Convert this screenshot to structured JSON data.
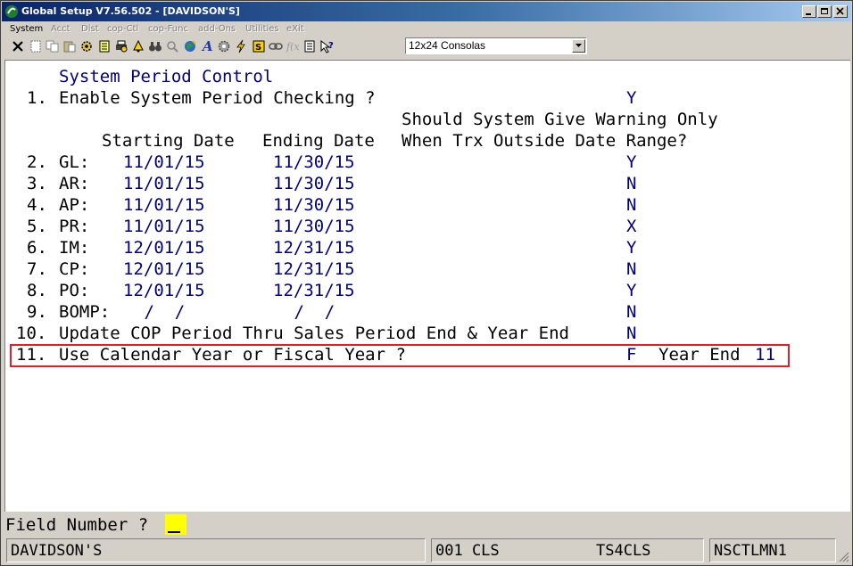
{
  "window": {
    "title": "Global Setup V7.56.502 - [DAVIDSON'S]"
  },
  "menu": {
    "items": [
      {
        "label": "System",
        "enabled": true
      },
      {
        "label": "Acct",
        "enabled": false
      },
      {
        "label": "Dist",
        "enabled": false
      },
      {
        "label": "cop-Ctl",
        "enabled": false
      },
      {
        "label": "cop-Func",
        "enabled": false
      },
      {
        "label": "add-Ons",
        "enabled": false
      },
      {
        "label": "Utilities",
        "enabled": false
      },
      {
        "label": "eXit",
        "enabled": false
      }
    ]
  },
  "toolbar": {
    "font_select_value": "12x24 Consolas",
    "icons": [
      "close-x-icon",
      "new-doc-icon",
      "copy-icon",
      "paste-icon",
      "settings-gear-icon",
      "notes-icon",
      "print-icon",
      "bell-icon",
      "binoculars-icon",
      "search-icon",
      "globe-icon",
      "font-icon",
      "gear-icon",
      "lightning-icon",
      "function-icon",
      "link-icon",
      "fx-icon",
      "list-icon",
      "help-pointer-icon"
    ]
  },
  "screen": {
    "heading": "System Period Control",
    "option1": {
      "number": "1.",
      "label": "Enable System Period Checking ?",
      "value": "Y"
    },
    "warning_header_line1": "Should System Give Warning Only",
    "warning_header_line2": "When Trx Outside Date Range?",
    "col_start": "Starting Date",
    "col_end": "Ending Date",
    "periods": [
      {
        "number": "2.",
        "code": "GL:",
        "start": "11/01/15",
        "end": "11/30/15",
        "warn": "Y"
      },
      {
        "number": "3.",
        "code": "AR:",
        "start": "11/01/15",
        "end": "11/30/15",
        "warn": "N"
      },
      {
        "number": "4.",
        "code": "AP:",
        "start": "11/01/15",
        "end": "11/30/15",
        "warn": "N"
      },
      {
        "number": "5.",
        "code": "PR:",
        "start": "11/01/15",
        "end": "11/30/15",
        "warn": "X"
      },
      {
        "number": "6.",
        "code": "IM:",
        "start": "12/01/15",
        "end": "12/31/15",
        "warn": "Y"
      },
      {
        "number": "7.",
        "code": "CP:",
        "start": "12/01/15",
        "end": "12/31/15",
        "warn": "N"
      },
      {
        "number": "8.",
        "code": "PO:",
        "start": "12/01/15",
        "end": "12/31/15",
        "warn": "Y"
      },
      {
        "number": "9.",
        "code": "BOMP:",
        "start": " /  /",
        "end": " /  /",
        "warn": "N"
      }
    ],
    "option10": {
      "number": "10.",
      "label": "Update COP Period Thru Sales Period End & Year End",
      "value": "N"
    },
    "option11": {
      "number": "11.",
      "label": "Use Calendar Year or Fiscal Year ?",
      "value": "F",
      "year_end_label": "Year End",
      "year_end_value": "11"
    }
  },
  "prompt": {
    "label": "Field Number ?",
    "value": ""
  },
  "status": {
    "company": "DAVIDSON'S",
    "code": "001 CLS",
    "server": "TS4CLS",
    "program": "NSCTLMN1"
  }
}
